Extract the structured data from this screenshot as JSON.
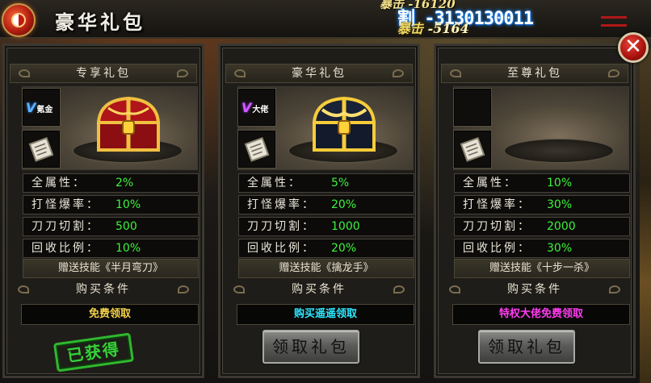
{
  "window": {
    "title": "豪华礼包"
  },
  "combat_text": {
    "line1": "暴击 -16120",
    "line2": "割 -3130130011",
    "line3_label": "暴击",
    "line3_value": "-5164"
  },
  "close_icon": "close-icon",
  "colors": {
    "stat_value": "#3cf23c",
    "cond_free": "#f4d24a",
    "cond_vip": "#2ee8ff",
    "cond_premium": "#ff3cf0",
    "claimed_stamp": "#39d03a"
  },
  "packs": [
    {
      "title": "专享礼包",
      "vip_badge": "氪金",
      "vip_color": "blue",
      "stats": [
        {
          "label": "全属性：",
          "value": "2%"
        },
        {
          "label": "打怪爆率：",
          "value": "10%"
        },
        {
          "label": "刀刀切割：",
          "value": "500"
        },
        {
          "label": "回收比例：",
          "value": "10%"
        }
      ],
      "skill": "赠送技能《半月弯刀》",
      "cond_title": "购买条件",
      "cond_text": "免费领取",
      "claimed_label": "已获得"
    },
    {
      "title": "豪华礼包",
      "vip_badge": "大佬",
      "vip_color": "purple",
      "stats": [
        {
          "label": "全属性：",
          "value": "5%"
        },
        {
          "label": "打怪爆率：",
          "value": "20%"
        },
        {
          "label": "刀刀切割：",
          "value": "1000"
        },
        {
          "label": "回收比例：",
          "value": "20%"
        }
      ],
      "skill": "赠送技能《擒龙手》",
      "cond_title": "购买条件",
      "cond_text": "购买遥遥领取",
      "button_label": "领取礼包"
    },
    {
      "title": "至尊礼包",
      "stats": [
        {
          "label": "全属性：",
          "value": "10%"
        },
        {
          "label": "打怪爆率：",
          "value": "30%"
        },
        {
          "label": "刀刀切割：",
          "value": "2000"
        },
        {
          "label": "回收比例：",
          "value": "30%"
        }
      ],
      "skill": "赠送技能《十步一杀》",
      "cond_title": "购买条件",
      "cond_text": "特权大佬免费领取",
      "button_label": "领取礼包"
    }
  ]
}
